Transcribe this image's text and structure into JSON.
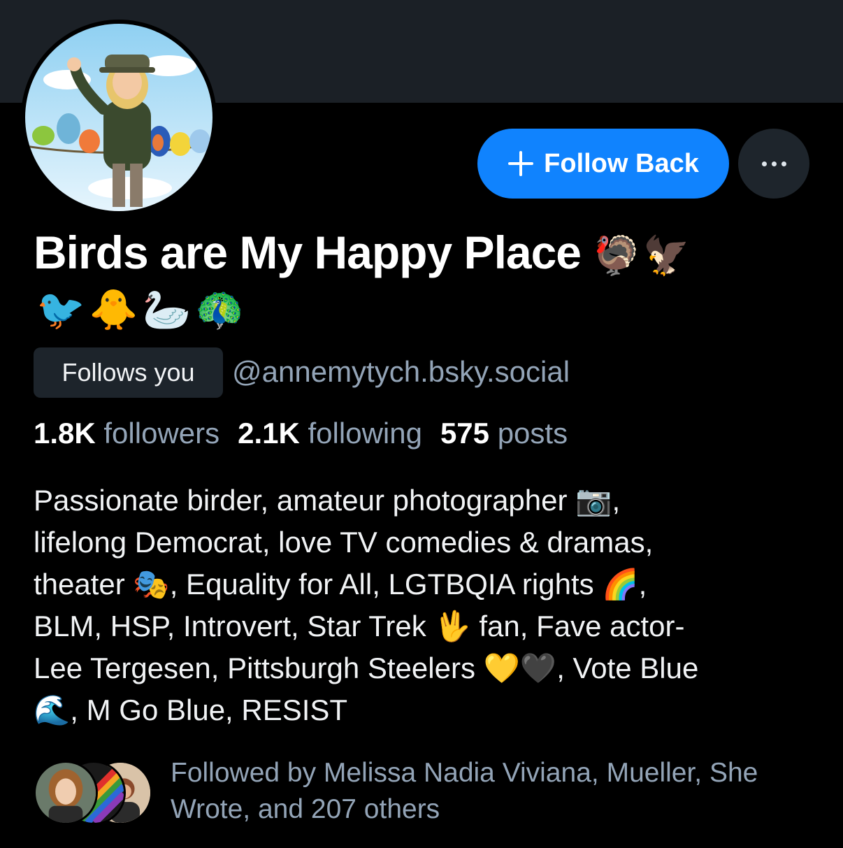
{
  "profile": {
    "display_name": "Birds are My Happy Place",
    "name_emojis": "🦃🦅",
    "name_emojis_line2": "🐦🐥🦢🦚",
    "follows_you_label": "Follows you",
    "handle": "@annemytych.bsky.social",
    "stats": {
      "followers_count": "1.8K",
      "followers_label": "followers",
      "following_count": "2.1K",
      "following_label": "following",
      "posts_count": "575",
      "posts_label": "posts"
    },
    "bio": "Passionate birder, amateur photographer 📷,\nlifelong Democrat, love TV comedies & dramas,\ntheater 🎭,  Equality for All, LGTBQIA rights 🌈,\nBLM, HSP, Introvert, Star Trek 🖖 fan, Fave actor-\nLee Tergesen, Pittsburgh Steelers 💛🖤, Vote Blue\n🌊, M Go Blue, RESIST",
    "followed_by_text": "Followed by Melissa Nadia Viviana, Mueller, She Wrote, and 207 others"
  },
  "actions": {
    "follow_back_label": "Follow Back",
    "follow_icon": "plus-icon",
    "more_icon": "ellipsis-icon"
  },
  "colors": {
    "accent": "#1083fe",
    "background": "#000000",
    "banner": "#1b2026",
    "muted_text": "#93a4b7",
    "badge_bg": "#1d242b"
  }
}
